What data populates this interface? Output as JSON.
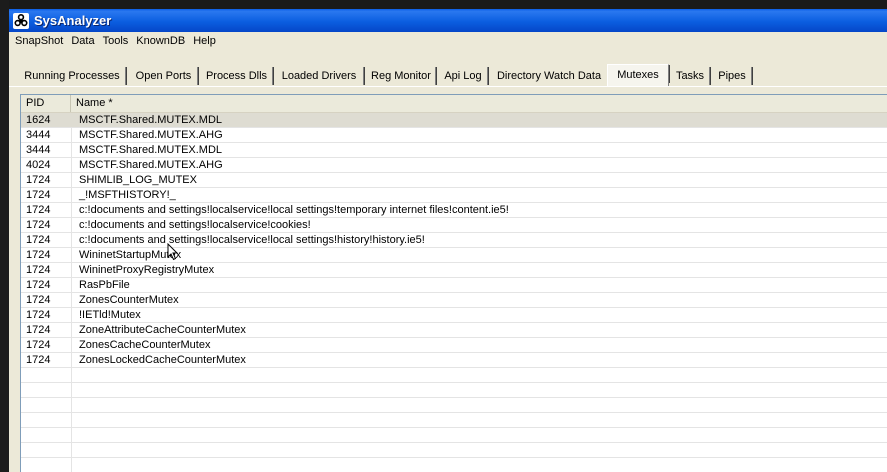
{
  "window": {
    "title": "SysAnalyzer"
  },
  "menu": [
    "SnapShot",
    "Data",
    "Tools",
    "KnownDB",
    "Help"
  ],
  "tabs": [
    {
      "label": "Running Processes"
    },
    {
      "label": "Open Ports"
    },
    {
      "label": "Process Dlls"
    },
    {
      "label": "Loaded Drivers"
    },
    {
      "label": "Reg Monitor"
    },
    {
      "label": "Api Log"
    },
    {
      "label": "Directory Watch Data"
    },
    {
      "label": "Mutexes"
    },
    {
      "label": "Tasks"
    },
    {
      "label": "Pipes"
    }
  ],
  "active_tab": "Mutexes",
  "list": {
    "columns": [
      "PID",
      "Name *"
    ],
    "rows": [
      {
        "pid": "1624",
        "name": "MSCTF.Shared.MUTEX.MDL"
      },
      {
        "pid": "3444",
        "name": "MSCTF.Shared.MUTEX.AHG"
      },
      {
        "pid": "3444",
        "name": "MSCTF.Shared.MUTEX.MDL"
      },
      {
        "pid": "4024",
        "name": "MSCTF.Shared.MUTEX.AHG"
      },
      {
        "pid": "1724",
        "name": "SHIMLIB_LOG_MUTEX"
      },
      {
        "pid": "1724",
        "name": "_!MSFTHISTORY!_"
      },
      {
        "pid": "1724",
        "name": "c:!documents and settings!localservice!local settings!temporary internet files!content.ie5!"
      },
      {
        "pid": "1724",
        "name": "c:!documents and settings!localservice!cookies!"
      },
      {
        "pid": "1724",
        "name": "c:!documents and settings!localservice!local settings!history!history.ie5!"
      },
      {
        "pid": "1724",
        "name": "WininetStartupMutex"
      },
      {
        "pid": "1724",
        "name": "WininetProxyRegistryMutex"
      },
      {
        "pid": "1724",
        "name": "RasPbFile"
      },
      {
        "pid": "1724",
        "name": "ZonesCounterMutex"
      },
      {
        "pid": "1724",
        "name": "!IETld!Mutex"
      },
      {
        "pid": "1724",
        "name": "ZoneAttributeCacheCounterMutex"
      },
      {
        "pid": "1724",
        "name": "ZonesCacheCounterMutex"
      },
      {
        "pid": "1724",
        "name": "ZonesLockedCacheCounterMutex"
      }
    ]
  }
}
